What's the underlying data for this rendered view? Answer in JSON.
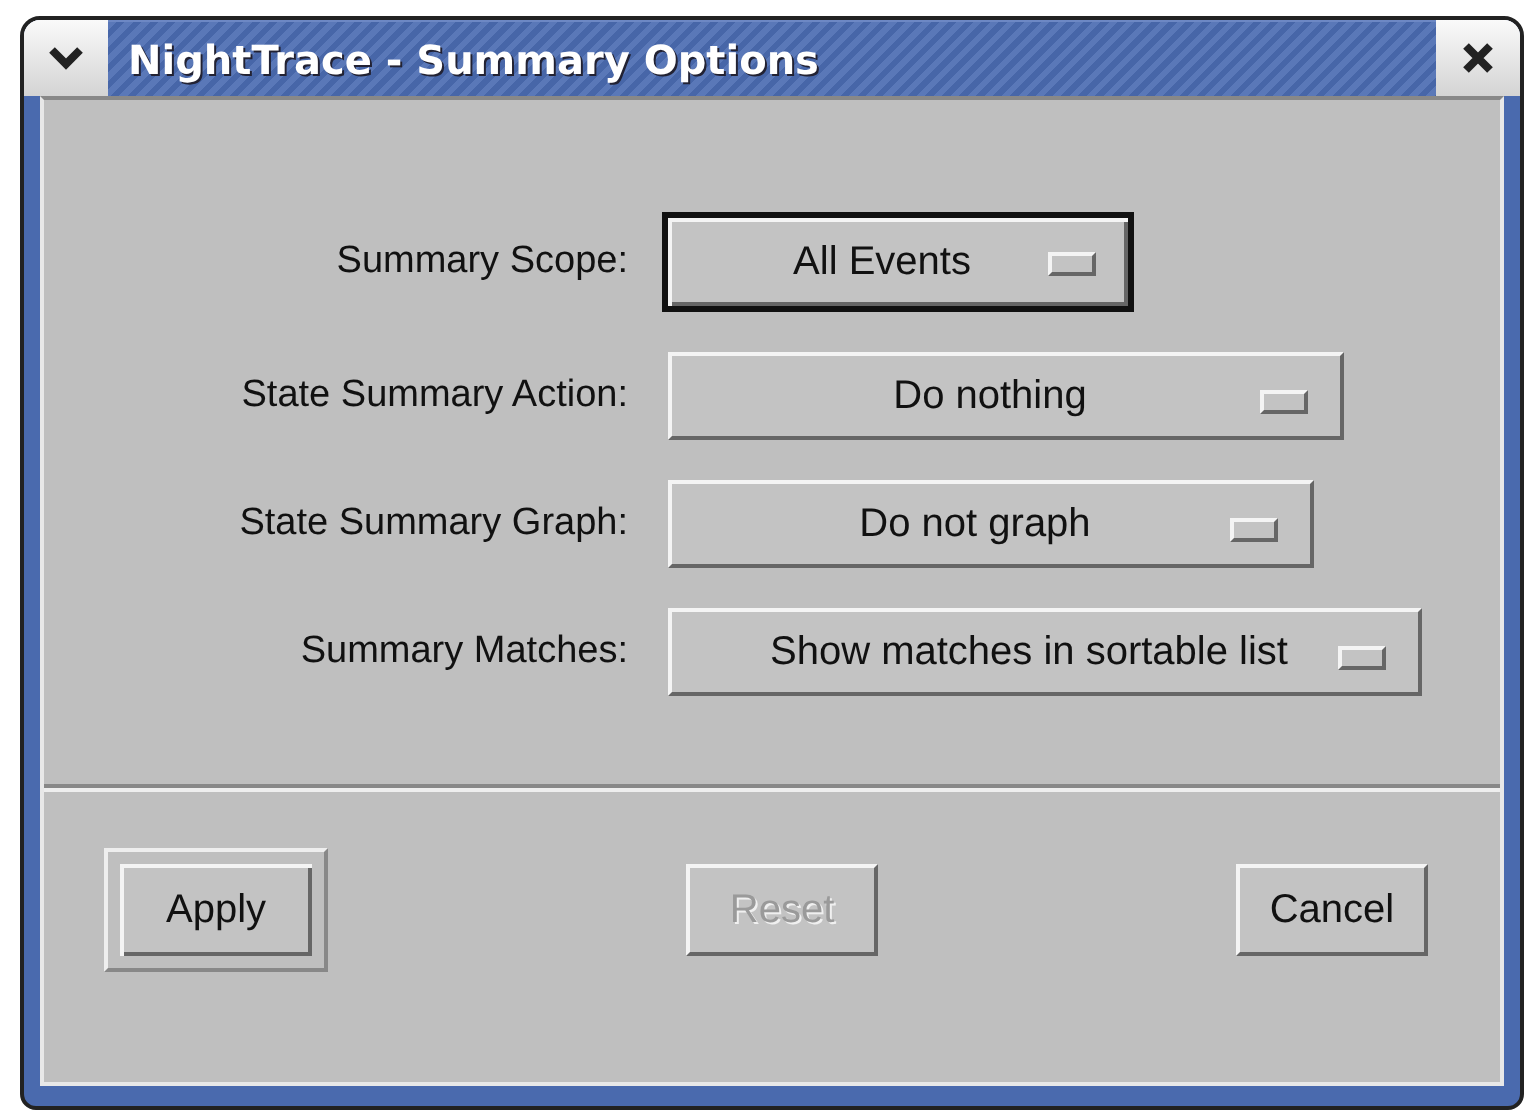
{
  "window": {
    "title": "NightTrace - Summary Options"
  },
  "options": [
    {
      "label": "Summary Scope:",
      "value": "All Events",
      "focused": true
    },
    {
      "label": "State Summary Action:",
      "value": "Do nothing",
      "focused": false
    },
    {
      "label": "State Summary Graph:",
      "value": "Do not graph",
      "focused": false
    },
    {
      "label": "Summary Matches:",
      "value": "Show matches in sortable list",
      "focused": false
    }
  ],
  "buttons": [
    {
      "label": "Apply",
      "default": true,
      "disabled": false
    },
    {
      "label": "Reset",
      "default": false,
      "disabled": true
    },
    {
      "label": "Cancel",
      "default": false,
      "disabled": false
    }
  ]
}
